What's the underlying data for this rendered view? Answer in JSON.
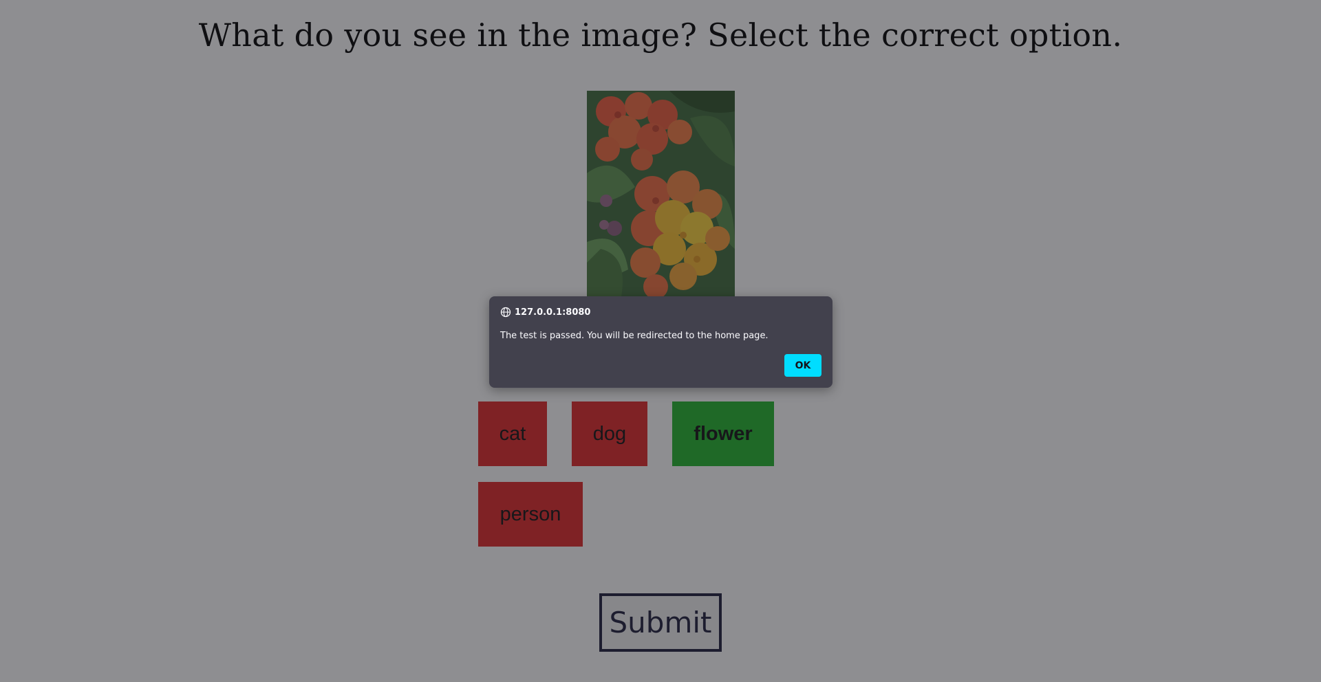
{
  "question": {
    "text": "What do you see in the image? Select the correct option."
  },
  "image": {
    "subject": "flower",
    "icon": "flower-photo"
  },
  "options": [
    {
      "label": "cat",
      "state": "incorrect",
      "color": "#e02727"
    },
    {
      "label": "dog",
      "state": "incorrect",
      "color": "#e02727"
    },
    {
      "label": "flower",
      "state": "correct",
      "color": "#20b52a"
    },
    {
      "label": "person",
      "state": "incorrect",
      "color": "#e02727"
    }
  ],
  "submit": {
    "label": "Submit"
  },
  "dialog": {
    "origin": "127.0.0.1:8080",
    "message": "The test is passed. You will be redirected to the home page.",
    "ok_label": "OK",
    "accent_color": "#00ddff",
    "background_color": "#42414d"
  }
}
